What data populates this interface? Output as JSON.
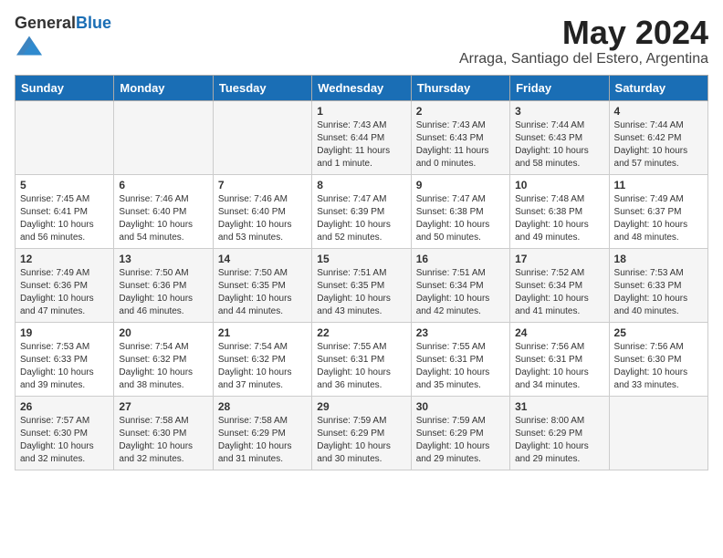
{
  "logo": {
    "general": "General",
    "blue": "Blue"
  },
  "title": {
    "month": "May 2024",
    "location": "Arraga, Santiago del Estero, Argentina"
  },
  "days_of_week": [
    "Sunday",
    "Monday",
    "Tuesday",
    "Wednesday",
    "Thursday",
    "Friday",
    "Saturday"
  ],
  "weeks": [
    [
      {
        "day": "",
        "info": ""
      },
      {
        "day": "",
        "info": ""
      },
      {
        "day": "",
        "info": ""
      },
      {
        "day": "1",
        "info": "Sunrise: 7:43 AM\nSunset: 6:44 PM\nDaylight: 11 hours\nand 1 minute."
      },
      {
        "day": "2",
        "info": "Sunrise: 7:43 AM\nSunset: 6:43 PM\nDaylight: 11 hours\nand 0 minutes."
      },
      {
        "day": "3",
        "info": "Sunrise: 7:44 AM\nSunset: 6:43 PM\nDaylight: 10 hours\nand 58 minutes."
      },
      {
        "day": "4",
        "info": "Sunrise: 7:44 AM\nSunset: 6:42 PM\nDaylight: 10 hours\nand 57 minutes."
      }
    ],
    [
      {
        "day": "5",
        "info": "Sunrise: 7:45 AM\nSunset: 6:41 PM\nDaylight: 10 hours\nand 56 minutes."
      },
      {
        "day": "6",
        "info": "Sunrise: 7:46 AM\nSunset: 6:40 PM\nDaylight: 10 hours\nand 54 minutes."
      },
      {
        "day": "7",
        "info": "Sunrise: 7:46 AM\nSunset: 6:40 PM\nDaylight: 10 hours\nand 53 minutes."
      },
      {
        "day": "8",
        "info": "Sunrise: 7:47 AM\nSunset: 6:39 PM\nDaylight: 10 hours\nand 52 minutes."
      },
      {
        "day": "9",
        "info": "Sunrise: 7:47 AM\nSunset: 6:38 PM\nDaylight: 10 hours\nand 50 minutes."
      },
      {
        "day": "10",
        "info": "Sunrise: 7:48 AM\nSunset: 6:38 PM\nDaylight: 10 hours\nand 49 minutes."
      },
      {
        "day": "11",
        "info": "Sunrise: 7:49 AM\nSunset: 6:37 PM\nDaylight: 10 hours\nand 48 minutes."
      }
    ],
    [
      {
        "day": "12",
        "info": "Sunrise: 7:49 AM\nSunset: 6:36 PM\nDaylight: 10 hours\nand 47 minutes."
      },
      {
        "day": "13",
        "info": "Sunrise: 7:50 AM\nSunset: 6:36 PM\nDaylight: 10 hours\nand 46 minutes."
      },
      {
        "day": "14",
        "info": "Sunrise: 7:50 AM\nSunset: 6:35 PM\nDaylight: 10 hours\nand 44 minutes."
      },
      {
        "day": "15",
        "info": "Sunrise: 7:51 AM\nSunset: 6:35 PM\nDaylight: 10 hours\nand 43 minutes."
      },
      {
        "day": "16",
        "info": "Sunrise: 7:51 AM\nSunset: 6:34 PM\nDaylight: 10 hours\nand 42 minutes."
      },
      {
        "day": "17",
        "info": "Sunrise: 7:52 AM\nSunset: 6:34 PM\nDaylight: 10 hours\nand 41 minutes."
      },
      {
        "day": "18",
        "info": "Sunrise: 7:53 AM\nSunset: 6:33 PM\nDaylight: 10 hours\nand 40 minutes."
      }
    ],
    [
      {
        "day": "19",
        "info": "Sunrise: 7:53 AM\nSunset: 6:33 PM\nDaylight: 10 hours\nand 39 minutes."
      },
      {
        "day": "20",
        "info": "Sunrise: 7:54 AM\nSunset: 6:32 PM\nDaylight: 10 hours\nand 38 minutes."
      },
      {
        "day": "21",
        "info": "Sunrise: 7:54 AM\nSunset: 6:32 PM\nDaylight: 10 hours\nand 37 minutes."
      },
      {
        "day": "22",
        "info": "Sunrise: 7:55 AM\nSunset: 6:31 PM\nDaylight: 10 hours\nand 36 minutes."
      },
      {
        "day": "23",
        "info": "Sunrise: 7:55 AM\nSunset: 6:31 PM\nDaylight: 10 hours\nand 35 minutes."
      },
      {
        "day": "24",
        "info": "Sunrise: 7:56 AM\nSunset: 6:31 PM\nDaylight: 10 hours\nand 34 minutes."
      },
      {
        "day": "25",
        "info": "Sunrise: 7:56 AM\nSunset: 6:30 PM\nDaylight: 10 hours\nand 33 minutes."
      }
    ],
    [
      {
        "day": "26",
        "info": "Sunrise: 7:57 AM\nSunset: 6:30 PM\nDaylight: 10 hours\nand 32 minutes."
      },
      {
        "day": "27",
        "info": "Sunrise: 7:58 AM\nSunset: 6:30 PM\nDaylight: 10 hours\nand 32 minutes."
      },
      {
        "day": "28",
        "info": "Sunrise: 7:58 AM\nSunset: 6:29 PM\nDaylight: 10 hours\nand 31 minutes."
      },
      {
        "day": "29",
        "info": "Sunrise: 7:59 AM\nSunset: 6:29 PM\nDaylight: 10 hours\nand 30 minutes."
      },
      {
        "day": "30",
        "info": "Sunrise: 7:59 AM\nSunset: 6:29 PM\nDaylight: 10 hours\nand 29 minutes."
      },
      {
        "day": "31",
        "info": "Sunrise: 8:00 AM\nSunset: 6:29 PM\nDaylight: 10 hours\nand 29 minutes."
      },
      {
        "day": "",
        "info": ""
      }
    ]
  ]
}
